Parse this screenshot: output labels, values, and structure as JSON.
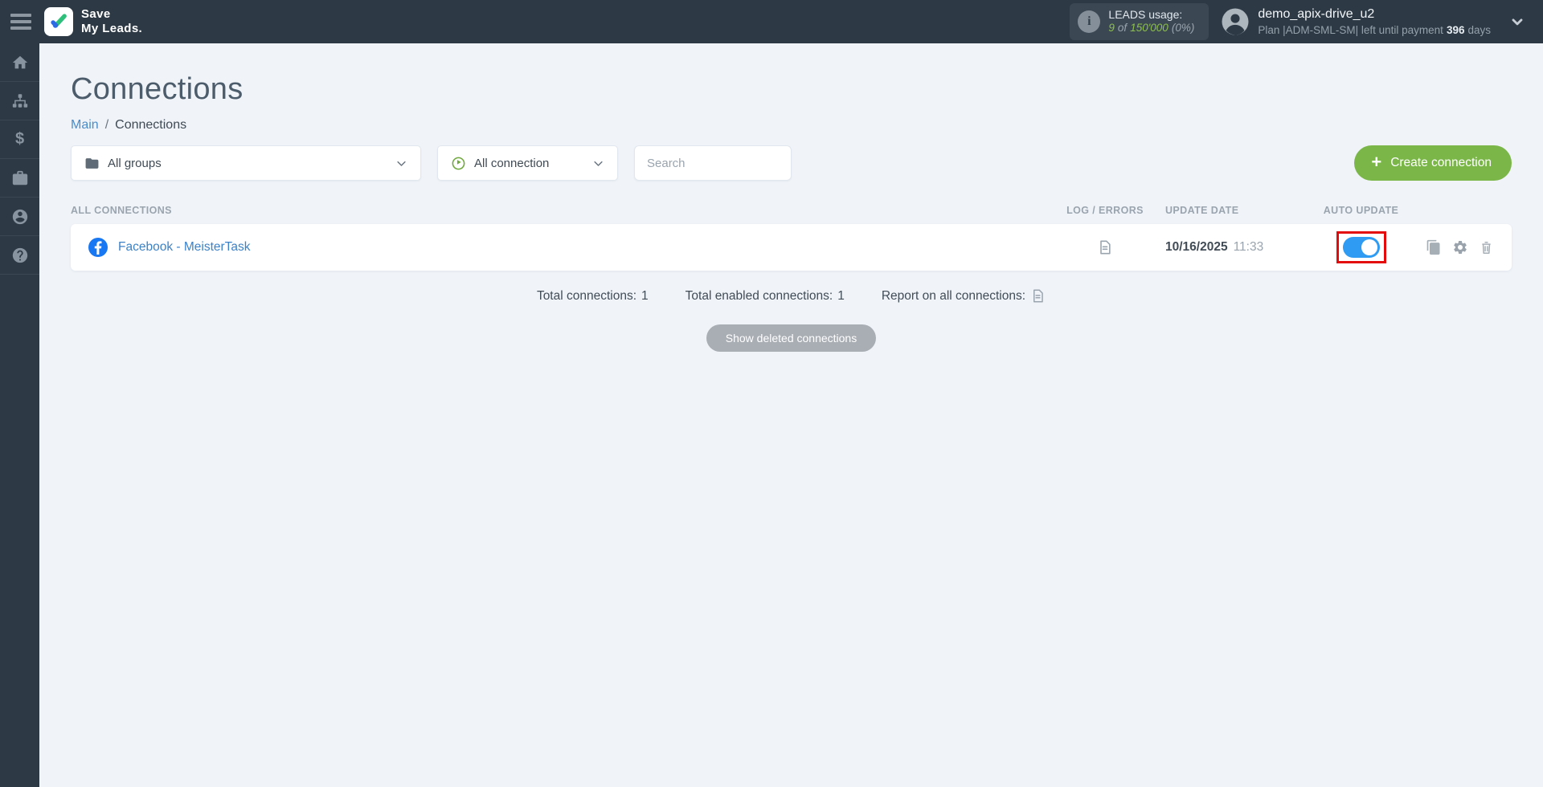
{
  "header": {
    "logo": {
      "line1": "Save",
      "line2": "My Leads."
    },
    "leads_usage": {
      "label": "LEADS usage:",
      "used": "9",
      "of_word": "of",
      "total": "150'000",
      "percent": "(0%)"
    },
    "user": {
      "name": "demo_apix-drive_u2",
      "plan_text": "Plan |ADM-SML-SM| left until payment",
      "days_value": "396",
      "days_suffix": "days"
    }
  },
  "sidebar": {
    "items": [
      {
        "icon": "home-icon"
      },
      {
        "icon": "sitemap-icon"
      },
      {
        "icon": "dollar-icon"
      },
      {
        "icon": "briefcase-icon"
      },
      {
        "icon": "user-icon"
      },
      {
        "icon": "help-icon"
      }
    ]
  },
  "page": {
    "title": "Connections",
    "breadcrumb": {
      "link": "Main",
      "separator": "/",
      "current": "Connections"
    }
  },
  "filters": {
    "groups_selected": "All groups",
    "connection_selected": "All connection",
    "search_placeholder": "Search"
  },
  "buttons": {
    "create": "Create connection",
    "show_deleted": "Show deleted connections"
  },
  "table": {
    "headers": {
      "name": "ALL CONNECTIONS",
      "log": "LOG / ERRORS",
      "date": "UPDATE DATE",
      "auto": "AUTO UPDATE"
    },
    "rows": [
      {
        "name": "Facebook - MeisterTask",
        "date": "10/16/2025",
        "time": "11:33",
        "auto_update": "on"
      }
    ]
  },
  "summary": {
    "total_label": "Total connections:",
    "total_value": "1",
    "enabled_label": "Total enabled connections:",
    "enabled_value": "1",
    "report_label": "Report on all connections:"
  },
  "colors": {
    "header_dark": "#2d3a46",
    "accent_green": "#7ab648",
    "leads_green": "#8dbf4c",
    "link_blue": "#3b82c8",
    "facebook_blue": "#1877f2",
    "toggle_blue": "#2f9bf2",
    "highlight_red": "#e30b0b"
  }
}
